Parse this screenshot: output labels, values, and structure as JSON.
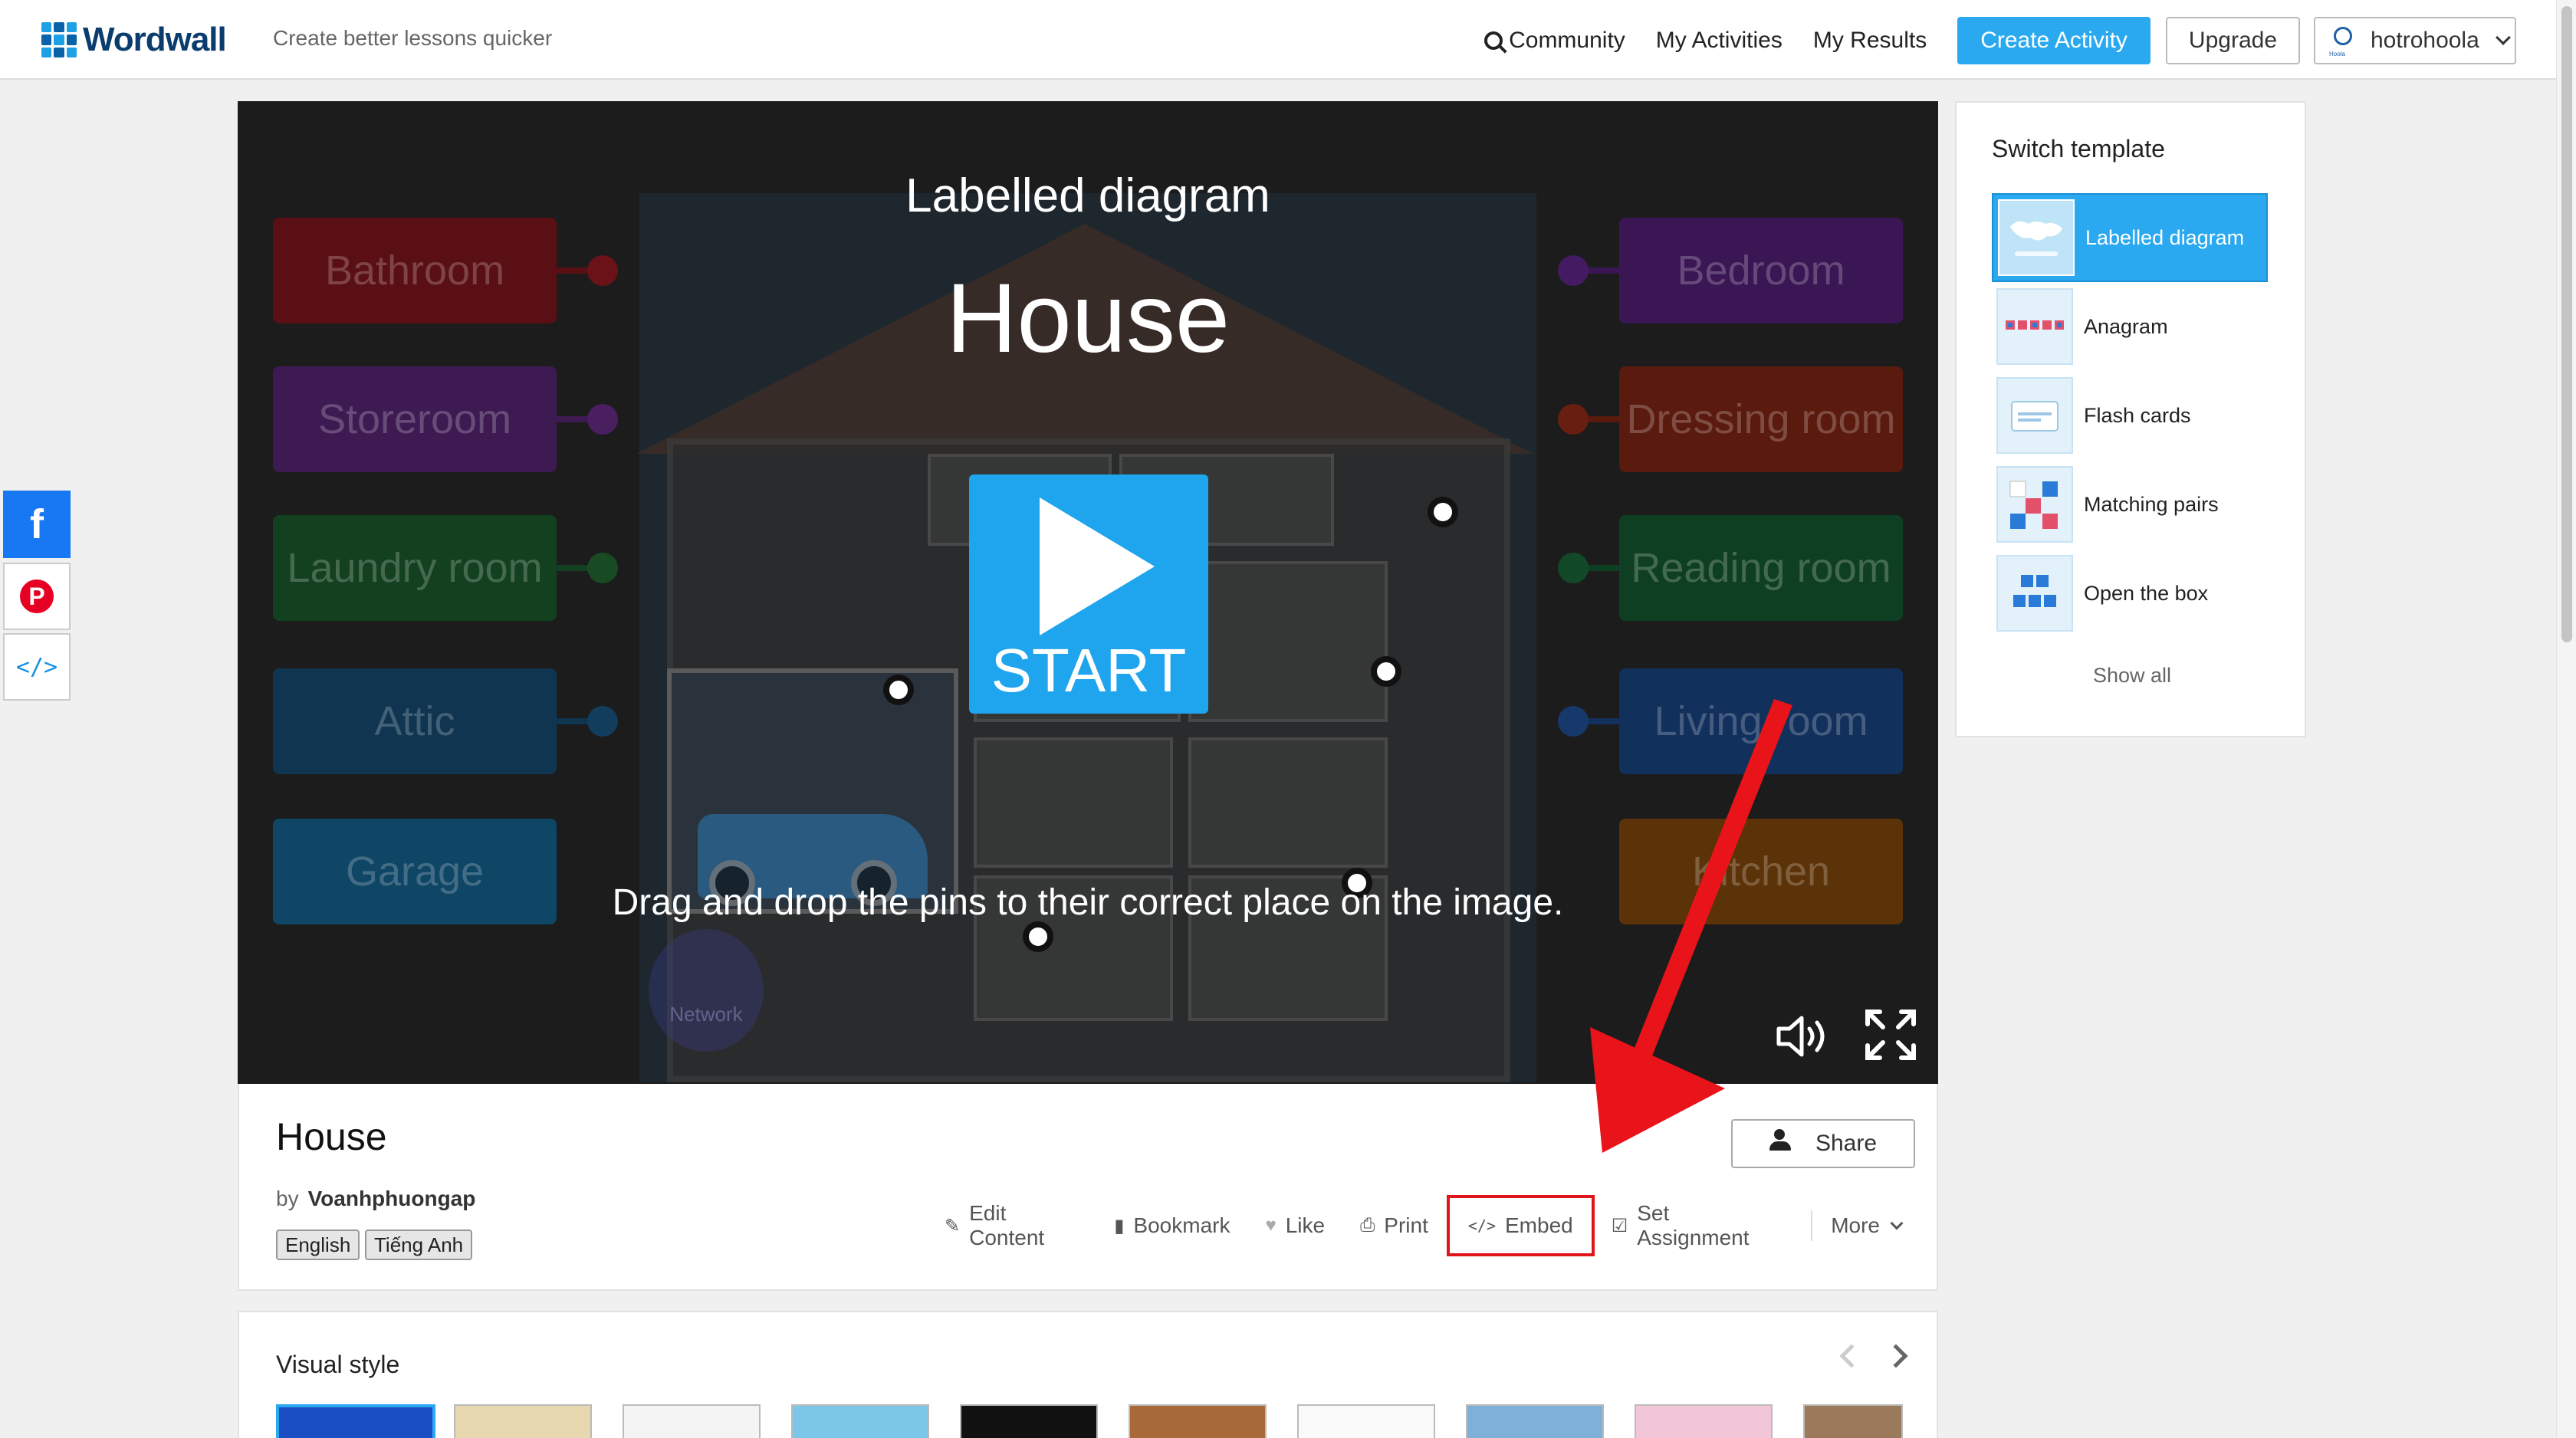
{
  "header": {
    "logo_text": "Wordwall",
    "tagline": "Create better lessons quicker",
    "nav": {
      "community": "Community",
      "my_activities": "My Activities",
      "my_results": "My Results",
      "create_activity": "Create Activity",
      "upgrade": "Upgrade",
      "username": "hotrohoola"
    }
  },
  "social": {
    "facebook_glyph": "f",
    "pinterest_glyph": "P",
    "embed_glyph": "</>"
  },
  "game": {
    "template_type": "Labelled diagram",
    "title": "House",
    "start_label": "START",
    "instruction": "Drag and drop the pins to their correct place on the image.",
    "watermark": "Network",
    "labels_left": [
      "Bathroom",
      "Storeroom",
      "Laundry room",
      "Attic",
      "Garage"
    ],
    "labels_right": [
      "Bedroom",
      "Dressing room",
      "Reading room",
      "Living room",
      "Kitchen"
    ],
    "label_colors_left": [
      "#5a0f14",
      "#3e1a52",
      "#13401f",
      "#0f3550",
      "#0f4565"
    ],
    "label_colors_right": [
      "#3a1654",
      "#5a1a0e",
      "#0f3f23",
      "#12305c",
      "#5c3208"
    ]
  },
  "activity": {
    "title": "House",
    "by_label": "by",
    "author": "Voanhphuongap",
    "tags": [
      "English",
      "Tiếng Anh"
    ],
    "share_label": "Share",
    "actions": {
      "edit": "Edit Content",
      "bookmark": "Bookmark",
      "like": "Like",
      "print": "Print",
      "embed": "Embed",
      "set_assignment": "Set Assignment",
      "more": "More"
    }
  },
  "visual_style": {
    "title": "Visual style"
  },
  "switch_template": {
    "title": "Switch template",
    "items": [
      {
        "label": "Labelled diagram",
        "active": true
      },
      {
        "label": "Anagram",
        "active": false
      },
      {
        "label": "Flash cards",
        "active": false
      },
      {
        "label": "Matching pairs",
        "active": false
      },
      {
        "label": "Open the box",
        "active": false
      }
    ],
    "show_all": "Show all"
  },
  "colors": {
    "accent": "#2aa9f0",
    "highlight_red": "#e0151b",
    "facebook": "#1877f2",
    "pinterest": "#e60023"
  }
}
